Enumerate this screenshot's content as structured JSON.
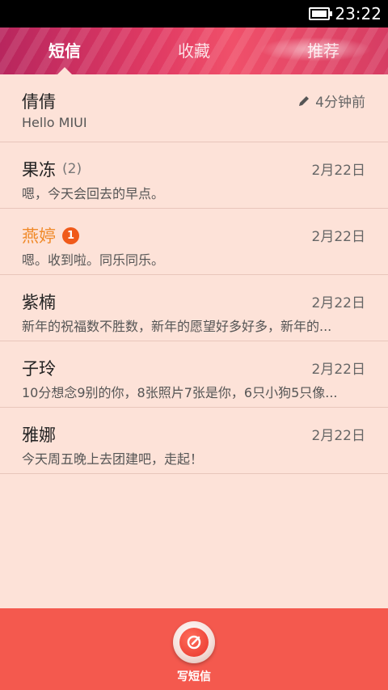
{
  "status_bar": {
    "time": "23:22"
  },
  "tabs": [
    {
      "label": "短信",
      "active": true
    },
    {
      "label": "收藏",
      "active": false
    },
    {
      "label": "推荐",
      "active": false
    }
  ],
  "messages": [
    {
      "name": "倩倩",
      "preview": "Hello MIUI",
      "date": "4分钟前",
      "draft": true
    },
    {
      "name": "果冻",
      "count": "(2)",
      "preview": "嗯，今天会回去的早点。",
      "date": "2月22日"
    },
    {
      "name": "燕婷",
      "unread_badge": "1",
      "preview": "嗯。收到啦。同乐同乐。",
      "date": "2月22日"
    },
    {
      "name": "紫楠",
      "preview": "新年的祝福数不胜数，新年的愿望好多好多，新年的...",
      "date": "2月22日"
    },
    {
      "name": "子玲",
      "preview": "10分想念9别的你，8张照片7张是你，6只小狗5只像...",
      "date": "2月22日"
    },
    {
      "name": "雅娜",
      "preview": "今天周五晚上去团建吧，走起！",
      "date": "2月22日"
    }
  ],
  "compose": {
    "label": "写短信",
    "icon": "compose-icon"
  },
  "colors": {
    "accent_bar": "#f4594e",
    "unread": "#f08a2a",
    "list_bg": "#fde2d8"
  }
}
